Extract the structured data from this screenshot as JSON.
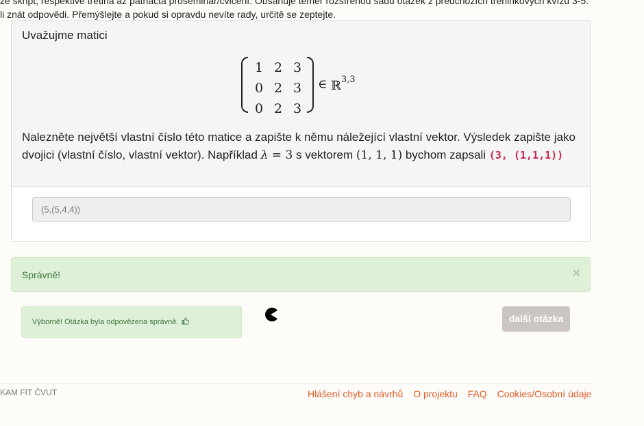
{
  "intro": {
    "line1": "ze skript, respektive třetina až patnácta proseminář/cvičení. Obsahuje téměř rozšířenou sadu otázek z předchozích tréninkových kvízů 3-5.",
    "line2": "li znát odpovědi. Přemýšlejte a pokud si opravdu nevíte rady, určitě se zeptejte."
  },
  "question": {
    "intro": "Uvažujme matici",
    "matrix": [
      [
        "1",
        "2",
        "3"
      ],
      [
        "0",
        "2",
        "3"
      ],
      [
        "0",
        "2",
        "3"
      ]
    ],
    "elem_of": "∈",
    "set": "ℝ",
    "set_dim": "3,3",
    "body_part1": "Nalezněte největší vlastní číslo této matice a zapište k němu náležející vlastní vektor. Výsledek zapište jako dvojici (vlastní číslo, vlastní vektor). Například ",
    "lambda": "λ",
    "eq": " = 3",
    "body_part2": " s vektorem ",
    "vector": "(1, 1, 1)",
    "body_part3": " bychom zapsali ",
    "example_code": "(3, (1,1,1))",
    "answer_value": "(5,(5,4,4))"
  },
  "alert": {
    "text": "Správně!",
    "close": "×"
  },
  "feedback": {
    "text": "Výborně! Otázka byla odpovězena správně.",
    "icon": "thumbs-up-icon"
  },
  "next_button": "další otázka",
  "footer": {
    "left": "KAM FIT ČVUT",
    "links": [
      "Hlášení chyb a návrhů",
      "O projektu",
      "FAQ",
      "Cookies/Osobní údaje"
    ]
  },
  "colors": {
    "success_bg": "#dff0d8",
    "success_text": "#3c763d",
    "link": "#e05a28",
    "code": "#c7254e",
    "button_disabled": "#cbc6c3"
  }
}
